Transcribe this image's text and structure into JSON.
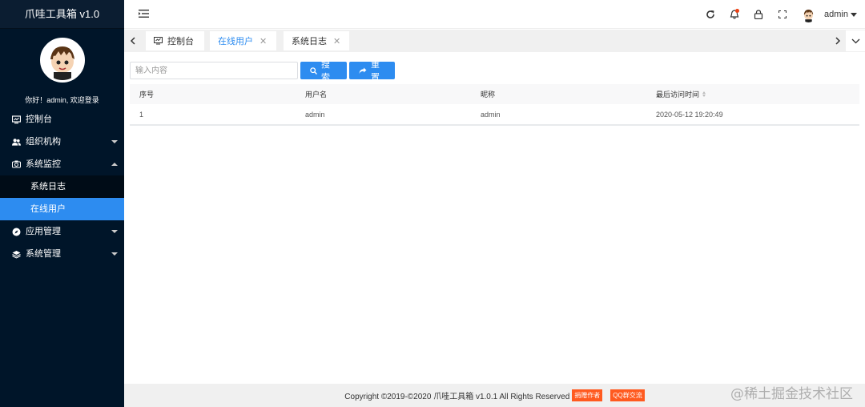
{
  "sidebar": {
    "brand": "爪哇工具箱 v1.0",
    "welcome": "你好！admin, 欢迎登录",
    "menu": [
      {
        "label": "控制台",
        "icon": "dashboard-icon"
      },
      {
        "label": "组织机构",
        "icon": "users-icon"
      },
      {
        "label": "系统监控",
        "icon": "camera-icon"
      },
      {
        "label": "应用管理",
        "icon": "compass-icon"
      },
      {
        "label": "系统管理",
        "icon": "layers-icon"
      }
    ],
    "submenu": [
      "系统日志",
      "在线用户"
    ]
  },
  "header": {
    "username": "admin"
  },
  "tabs": [
    "控制台",
    "在线用户",
    "系统日志"
  ],
  "search": {
    "placeholder": "输入内容",
    "search_label": "搜索",
    "reset_label": "重置"
  },
  "table": {
    "headers": [
      "序号",
      "用户名",
      "昵称",
      "最后访问时间"
    ],
    "rows": [
      [
        "1",
        "admin",
        "admin",
        "2020-05-12 19:20:49"
      ]
    ]
  },
  "footer": {
    "copyright": "Copyright ©2019-©2020 爪哇工具箱 v1.0.1 All Rights Reserved",
    "badge_donate": "捐赠作者",
    "badge_qq": "QQ群交流"
  },
  "watermark": "@稀土掘金技术社区",
  "colors": {
    "sidebar_bg": "#001529",
    "accent": "#2d8cf0",
    "badge": "#ff5a1f"
  }
}
